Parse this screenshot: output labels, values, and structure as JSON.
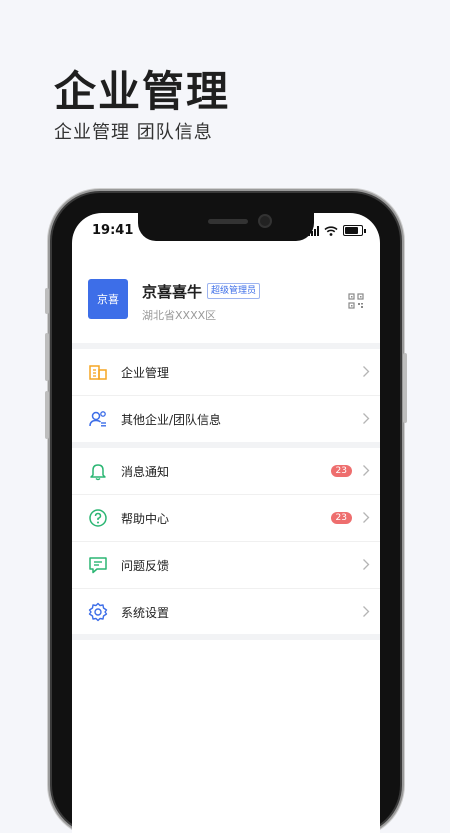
{
  "hero": {
    "title": "企业管理",
    "subtitle": "企业管理  团队信息"
  },
  "status_bar": {
    "time": "19:41"
  },
  "profile": {
    "avatar_text": "京喜",
    "name": "京喜喜牛",
    "role": "超级管理员",
    "location": "湖北省XXXX区"
  },
  "menu_group_1": [
    {
      "label": "企业管理",
      "icon": "building-icon"
    },
    {
      "label": "其他企业/团队信息",
      "icon": "team-info-icon"
    }
  ],
  "menu_group_2": [
    {
      "label": "消息通知",
      "icon": "bell-icon",
      "badge": "23"
    },
    {
      "label": "帮助中心",
      "icon": "help-icon",
      "badge": "23"
    },
    {
      "label": "问题反馈",
      "icon": "feedback-icon"
    },
    {
      "label": "系统设置",
      "icon": "gear-icon"
    }
  ],
  "colors": {
    "accent": "#3d6ee8",
    "icon_green": "#2bb673",
    "icon_orange": "#f5a623",
    "badge_red": "#ee6e6e"
  }
}
